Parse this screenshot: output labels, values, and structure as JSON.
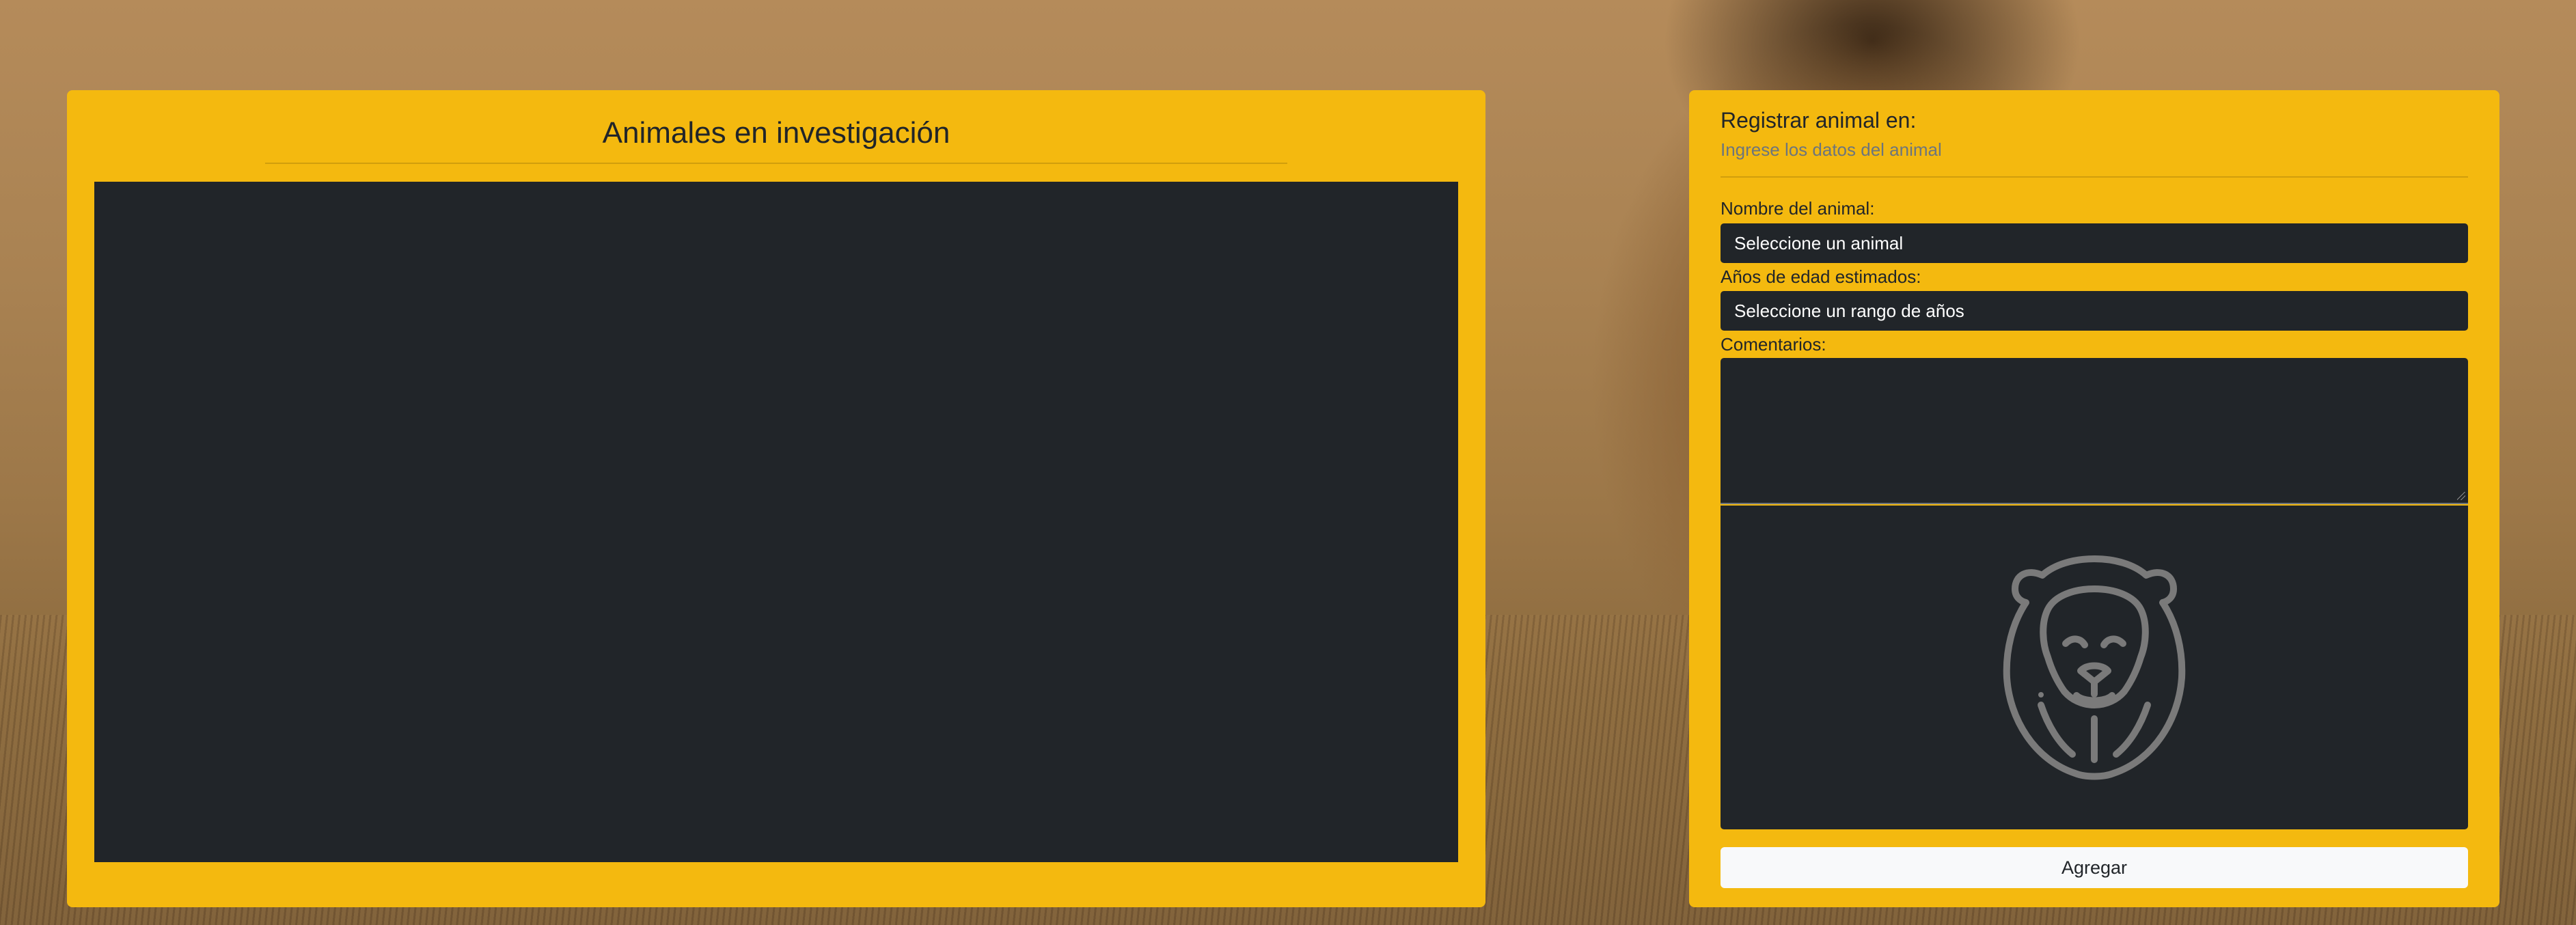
{
  "left_panel": {
    "title": "Animales en investigación"
  },
  "form": {
    "title": "Registrar animal en:",
    "subtitle": "Ingrese los datos del animal",
    "animal_label": "Nombre del animal:",
    "animal_select_value": "Seleccione un animal",
    "age_label": "Años de edad estimados:",
    "age_select_value": "Seleccione un rango de años",
    "comments_label": "Comentarios:",
    "comments_value": "",
    "preview_icon": "lion-icon",
    "submit_label": "Agregar"
  },
  "colors": {
    "panel": "#f4b90f",
    "dark": "#212529",
    "button": "#f8f9fa",
    "muted": "#6c757d"
  }
}
